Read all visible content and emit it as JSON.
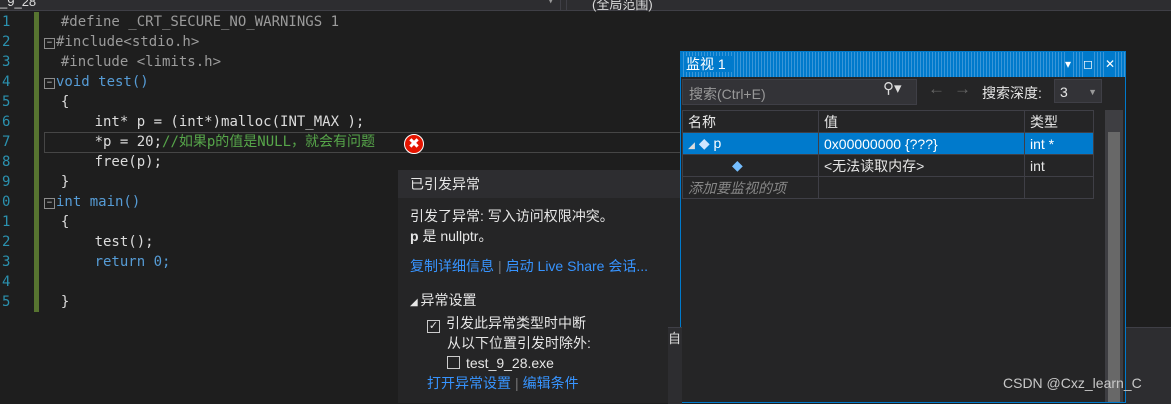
{
  "toolbar": {
    "file_dropdown": "_9_28",
    "scope_dropdown": "(全局范围)"
  },
  "editor": {
    "line_numbers": [
      "1",
      "2",
      "3",
      "4",
      "5",
      "6",
      "7",
      "8",
      "9",
      "0",
      "1",
      "2",
      "3",
      "4",
      "5"
    ],
    "lines": [
      "#define _CRT_SECURE_NO_WARNINGS 1",
      "#include<stdio.h>",
      "#include <limits.h>",
      "void test()",
      "{",
      "int* p = (int*)malloc(INT_MAX );",
      "*p = 20;",
      "//如果p的值是NULL，就会有问题",
      "free(p);",
      "}",
      "int main()",
      "{",
      "test();",
      "return 0;",
      "}"
    ],
    "error_glyph": "✖"
  },
  "exception": {
    "title": "已引发异常",
    "message_line1": "引发了异常: 写入访问权限冲突。",
    "message_p": "p",
    "message_rest": " 是 nullptr。",
    "link_copy": "复制详细信息",
    "link_liveshare": "启动 Live Share 会话...",
    "settings_header": "异常设置",
    "break_option": "引发此异常类型时中断",
    "except_label": "从以下位置引发时除外:",
    "except_module": "test_9_28.exe",
    "link_open_settings": "打开异常设置",
    "link_edit_conditions": "编辑条件"
  },
  "watch": {
    "title": "监视 1",
    "search_placeholder": "搜索(Ctrl+E)",
    "depth_label": "搜索深度:",
    "depth_value": "3",
    "columns": [
      "名称",
      "值",
      "类型"
    ],
    "rows": [
      {
        "name": "p",
        "value": "0x00000000 {???}",
        "type": "int *"
      },
      {
        "name": "",
        "value": "<无法读取内存>",
        "type": "int"
      }
    ],
    "add_placeholder": "添加要监视的项"
  },
  "partial_tab": "自",
  "watermark": "CSDN @Cxz_learn_C",
  "colors": {
    "accent": "#007acc",
    "error": "#e51400",
    "keyword": "#569cd6",
    "comment": "#57a64a",
    "string": "#d69d85",
    "line_number": "#2b91af"
  }
}
